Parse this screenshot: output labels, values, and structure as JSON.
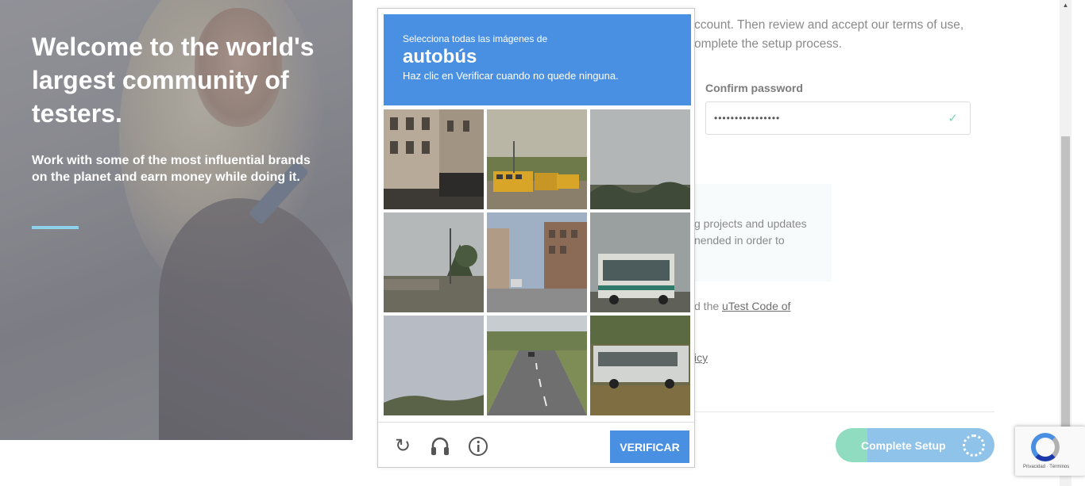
{
  "hero": {
    "title": "Welcome to the world's largest community of testers.",
    "subtitle": "Work with some of the most influential brands on the planet and earn money while doing it."
  },
  "form": {
    "intro": "ccount. Then review and accept our terms of use, omplete the setup process.",
    "confirm_password_label": "Confirm password",
    "confirm_password_value": "••••••••••••••••",
    "check_icon": "✓",
    "info_text": "g projects and updates nended in order to",
    "agree_prefix": "d the ",
    "agree_link": "uTest Code of",
    "policy_link": "icy",
    "complete_button": "Complete Setup"
  },
  "captcha": {
    "instruction_top": "Selecciona todas las imágenes de",
    "target": "autobús",
    "instruction_bottom": "Haz clic en Verificar cuando no quede ninguna.",
    "verify_button": "VERIFICAR",
    "tiles": [
      "building-street",
      "school-buses",
      "sky-trees",
      "street-lamp-trees",
      "city-street",
      "transit-bus",
      "sky-noise",
      "highway",
      "white-bus"
    ],
    "icons": [
      "reload-icon",
      "headphones-icon",
      "info-icon"
    ]
  },
  "badge": {
    "links": "Privacidad · Términos"
  },
  "colors": {
    "captcha_blue": "#4a90e2",
    "hero_accent": "#8fd0ea",
    "button_green": "#8fdcc0",
    "button_blue": "#8fc3ea"
  }
}
